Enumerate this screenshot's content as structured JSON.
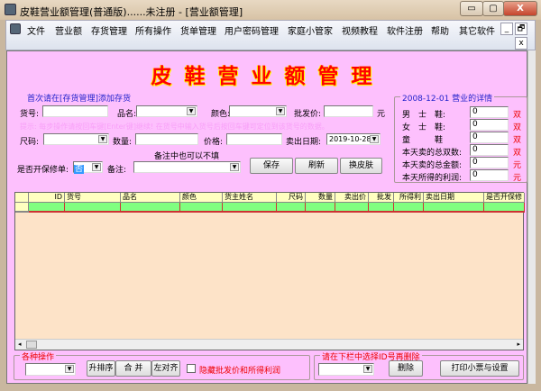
{
  "window": {
    "title": "皮鞋营业额管理(普通版)......未注册 - [营业额管理]",
    "minimize": "▭",
    "maximize": "▢",
    "close": "X"
  },
  "menu": [
    "文件",
    "营业额",
    "存货管理",
    "所有操作",
    "货单管理",
    "用户密码管理",
    "家庭小管家",
    "视频教程",
    "软件注册",
    "帮助",
    "其它软件"
  ],
  "mdi": {
    "minimize": "_",
    "restore": "🗗",
    "close": "x"
  },
  "heading": "皮鞋营业额管理",
  "form": {
    "first_hint": "首次请在[存货管理]添加存货",
    "goods_no_label": "货号:",
    "goods_no": "",
    "name_label": "品名:",
    "name": "",
    "color_label": "颜色:",
    "color": "",
    "wholesale_label": "批发价:",
    "wholesale": "",
    "yuan": "元",
    "tip": "提示: 每步操作请按回车键[Enter键]继续! 在货号中输入货号后按回车键可定位到该货号的数据。",
    "size_label": "尺码:",
    "size": "",
    "qty_label": "数量:",
    "qty": "",
    "price_label": "价格:",
    "price": "",
    "date_label": "卖出日期:",
    "date": "2019-10-28",
    "remark_hint": "备注中也可以不填",
    "warranty_label": "是否开保修单:",
    "warranty": "否",
    "remark_label": "备注:",
    "remark": "",
    "save": "保存",
    "refresh": "刷新",
    "skin": "换皮肤"
  },
  "summary": {
    "title": "2008-12-01 营业的详情",
    "rows": [
      {
        "label": "男　士　鞋:",
        "value": "0",
        "unit": "双"
      },
      {
        "label": "女　士　鞋:",
        "value": "0",
        "unit": "双"
      },
      {
        "label": "童　　　鞋",
        "value": "0",
        "unit": "双"
      },
      {
        "label": "本天卖的总双数:",
        "value": "0",
        "unit": "双"
      },
      {
        "label": "本天卖的总金额:",
        "value": "0",
        "unit": "元"
      },
      {
        "label": "本天所得的利润:",
        "value": "0",
        "unit": "元"
      }
    ]
  },
  "grid": {
    "columns": [
      "ID",
      "货号",
      "品名",
      "颜色",
      "货主姓名",
      "尺码",
      "数量",
      "卖出价",
      "批发",
      "所得利",
      "卖出日期",
      "是否开保修"
    ]
  },
  "ops": {
    "title": "各种操作",
    "select": "",
    "sort": "升排序",
    "merge": "合 并",
    "align_left": "左对齐",
    "hide_label": "隐藏批发价和所得利润"
  },
  "del": {
    "title": "请在下栏中选择ID号再删除",
    "select": "",
    "delete": "删除",
    "print": "打印小票与设置"
  },
  "colors": {
    "content_bg": "#fdc0fd",
    "title_red": "#ff0000",
    "grid_row": "#80ff80",
    "grid_bg": "#fde3c8"
  }
}
